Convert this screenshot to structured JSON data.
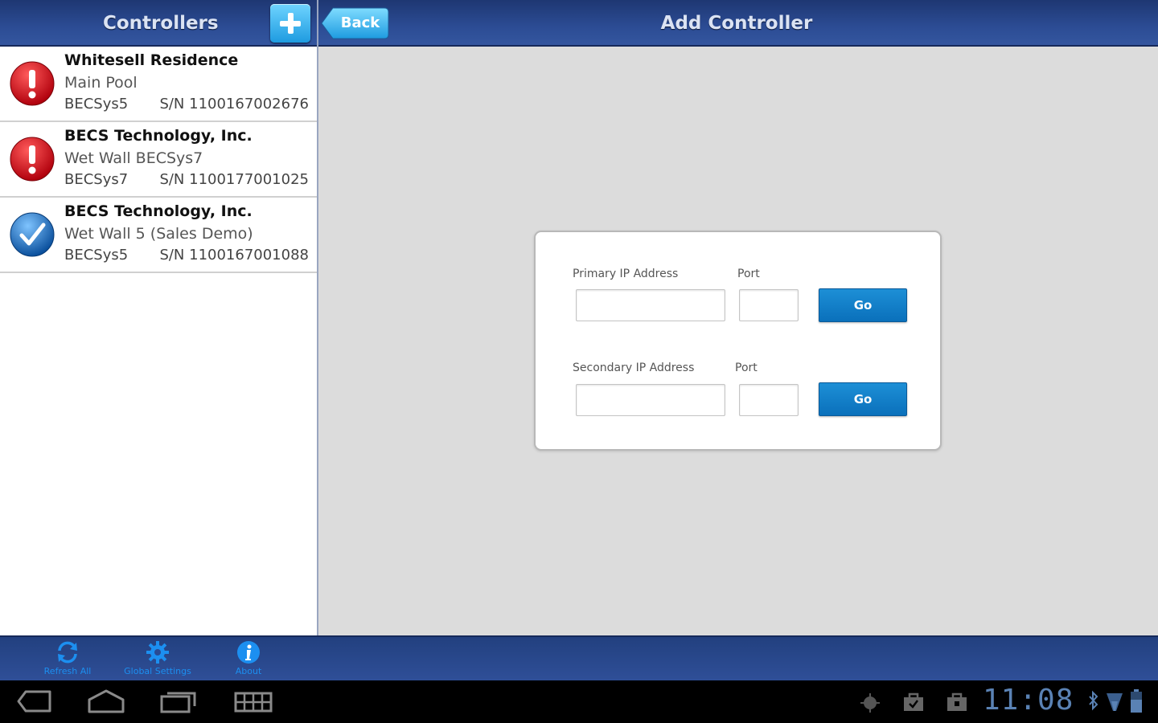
{
  "left_header": {
    "title": "Controllers"
  },
  "right_header": {
    "title": "Add Controller",
    "back_label": "Back"
  },
  "controllers": [
    {
      "name": "Whitesell Residence",
      "location": "Main Pool",
      "model": "BECSys5",
      "serial": "S/N 1100167002676",
      "status": "error"
    },
    {
      "name": "BECS Technology, Inc.",
      "location": "Wet Wall BECSys7",
      "model": "BECSys7",
      "serial": "S/N 1100177001025",
      "status": "error"
    },
    {
      "name": "BECS Technology, Inc.",
      "location": "Wet Wall 5 (Sales Demo)",
      "model": "BECSys5",
      "serial": "S/N 1100167001088",
      "status": "ok"
    }
  ],
  "form": {
    "primary": {
      "ip_label": "Primary IP Address",
      "port_label": "Port",
      "ip_value": "",
      "port_value": "",
      "go_label": "Go"
    },
    "secondary": {
      "ip_label": "Secondary IP Address",
      "port_label": "Port",
      "ip_value": "",
      "port_value": "",
      "go_label": "Go"
    }
  },
  "toolbar": {
    "items": [
      {
        "label": "Refresh All",
        "icon": "refresh-icon"
      },
      {
        "label": "Global Settings",
        "icon": "gear-icon"
      },
      {
        "label": "About",
        "icon": "info-icon"
      }
    ]
  },
  "status_bar": {
    "time": "11:08"
  },
  "colors": {
    "header": "#2c4c94",
    "accent": "#1e9be0",
    "error": "#d0101c",
    "ok": "#1a6fc0",
    "go_button": "#0a70bb"
  }
}
